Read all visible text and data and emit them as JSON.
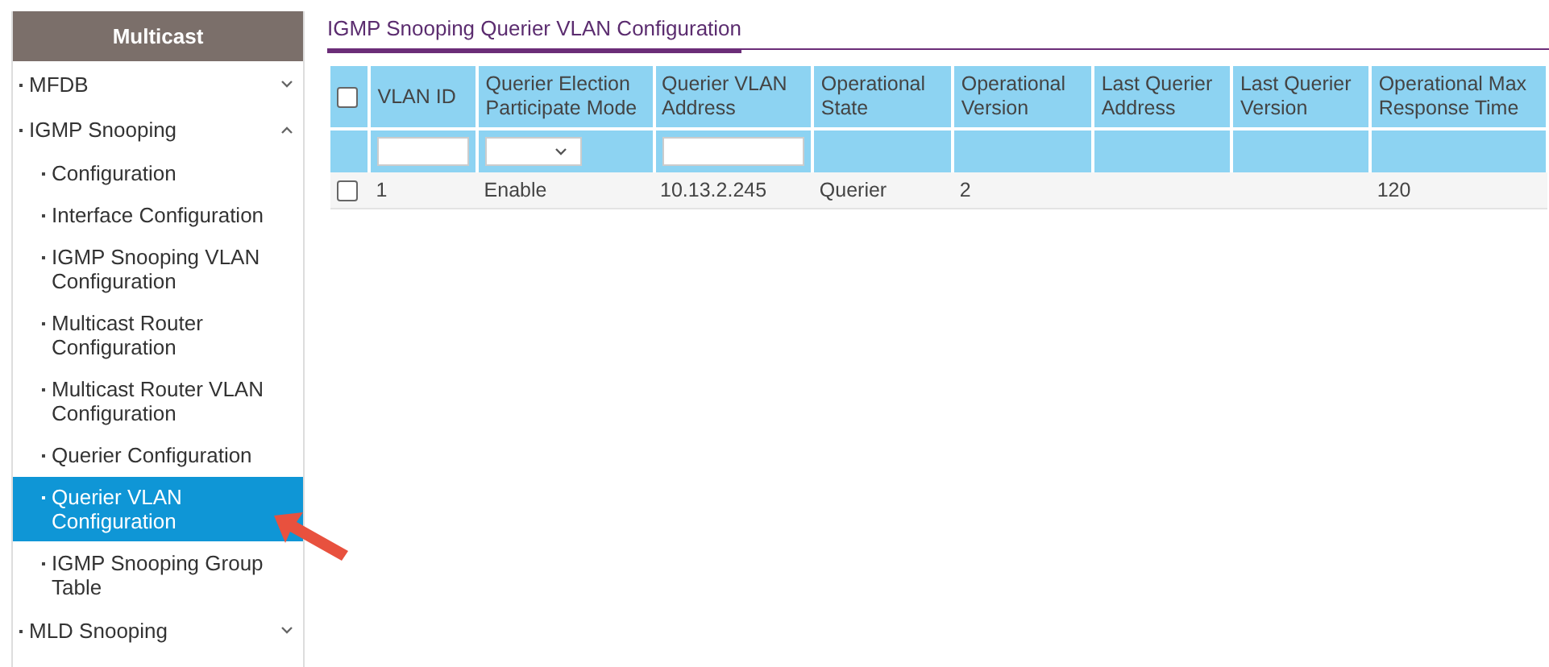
{
  "sidebar": {
    "title": "Multicast",
    "items": [
      {
        "label": "MFDB",
        "expanded": false,
        "selected": false
      },
      {
        "label": "IGMP Snooping",
        "expanded": true,
        "selected": false,
        "children": [
          {
            "label": "Configuration",
            "selected": false
          },
          {
            "label": "Interface Configuration",
            "selected": false
          },
          {
            "label": "IGMP Snooping VLAN Configuration",
            "selected": false
          },
          {
            "label": "Multicast Router Configuration",
            "selected": false
          },
          {
            "label": "Multicast Router VLAN Configuration",
            "selected": false
          },
          {
            "label": "Querier Configuration",
            "selected": false
          },
          {
            "label": "Querier VLAN Configuration",
            "selected": true
          },
          {
            "label": "IGMP Snooping Group Table",
            "selected": false
          }
        ]
      },
      {
        "label": "MLD Snooping",
        "expanded": false,
        "selected": false
      }
    ]
  },
  "page": {
    "title": "IGMP Snooping Querier VLAN Configuration"
  },
  "table": {
    "select_all": {
      "checked": false
    },
    "columns": [
      {
        "label": "VLAN ID",
        "kind": "textfilter"
      },
      {
        "label": "Querier Election Participate Mode",
        "kind": "selectfilter"
      },
      {
        "label": "Querier VLAN Address",
        "kind": "textfilter"
      },
      {
        "label": "Operational State",
        "kind": "plain"
      },
      {
        "label": "Operational Version",
        "kind": "plain"
      },
      {
        "label": "Last Querier Address",
        "kind": "plain"
      },
      {
        "label": "Last Querier Version",
        "kind": "plain"
      },
      {
        "label": "Operational Max Response Time",
        "kind": "plain"
      }
    ],
    "rows": [
      {
        "checked": false,
        "cells": [
          "1",
          "Enable",
          "10.13.2.245",
          "Querier",
          "2",
          "",
          "",
          "120"
        ]
      }
    ]
  }
}
